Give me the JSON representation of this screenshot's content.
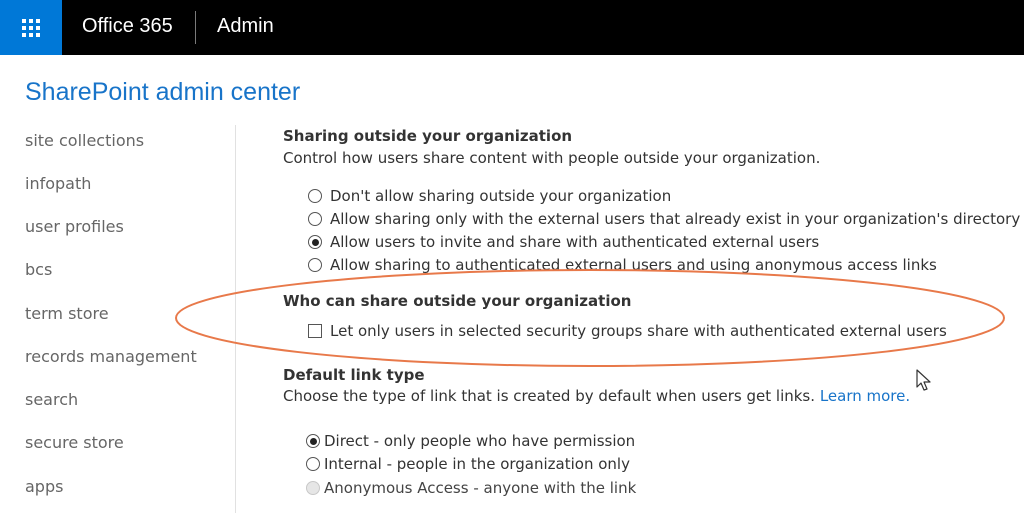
{
  "topbar": {
    "app_launcher_icon": "waffle-grid-icon",
    "brand": "Office 365",
    "app_name": "Admin",
    "colors": {
      "bar": "#000000",
      "launcher": "#0078d7"
    }
  },
  "header": {
    "title": "SharePoint admin center",
    "title_color": "#1874c9"
  },
  "sidebar": {
    "items": [
      {
        "label": "site collections"
      },
      {
        "label": "infopath"
      },
      {
        "label": "user profiles"
      },
      {
        "label": "bcs"
      },
      {
        "label": "term store"
      },
      {
        "label": "records management"
      },
      {
        "label": "search"
      },
      {
        "label": "secure store"
      },
      {
        "label": "apps"
      }
    ]
  },
  "sharing": {
    "title": "Sharing outside your organization",
    "description": "Control how users share content with people outside your organization.",
    "options": [
      {
        "label": "Don't allow sharing outside your organization",
        "checked": false
      },
      {
        "label": "Allow sharing only with the external users that already exist in your organization's directory",
        "checked": false
      },
      {
        "label": "Allow users to invite and share with authenticated external users",
        "checked": true
      },
      {
        "label": "Allow sharing to authenticated external users and using anonymous access links",
        "checked": false
      }
    ]
  },
  "who_can_share": {
    "title": "Who can share outside your organization",
    "checkbox_label": "Let only users in selected security groups share with authenticated external users",
    "checked": false,
    "highlight_color": "#e8794a"
  },
  "default_link": {
    "title": "Default link type",
    "description": "Choose the type of link that is created by default when users get links.",
    "learn_more": "Learn more.",
    "options": [
      {
        "label": "Direct - only people who have permission",
        "checked": true,
        "disabled": false
      },
      {
        "label": "Internal - people in the organization only",
        "checked": false,
        "disabled": false
      },
      {
        "label": "Anonymous Access - anyone with the link",
        "checked": false,
        "disabled": true
      }
    ]
  },
  "cursor_icon": "mouse-pointer-icon"
}
